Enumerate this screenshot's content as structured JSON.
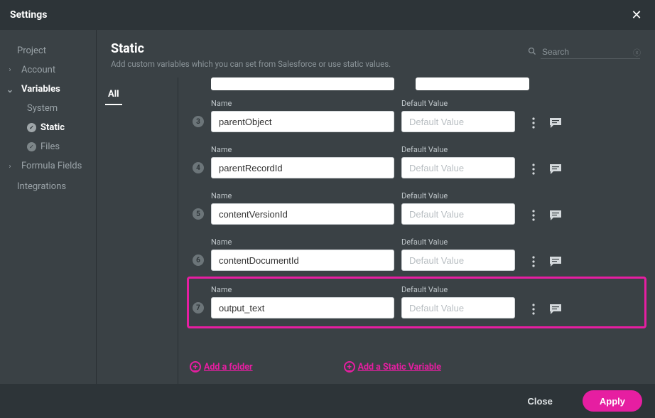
{
  "titlebar": {
    "title": "Settings"
  },
  "sidebar": {
    "items": [
      {
        "label": "Project",
        "chev": ""
      },
      {
        "label": "Account",
        "chev": "›"
      },
      {
        "label": "Variables",
        "chev": "⌄",
        "active": true
      },
      {
        "label": "System",
        "indent": true
      },
      {
        "label": "Static",
        "indent": true,
        "check": true,
        "active": true
      },
      {
        "label": "Files",
        "indent": true,
        "check": true
      },
      {
        "label": "Formula Fields",
        "chev": "›"
      },
      {
        "label": "Integrations",
        "chev": ""
      }
    ]
  },
  "header": {
    "title": "Static",
    "subtitle": "Add custom variables which you can set from Salesforce or use static values."
  },
  "search": {
    "placeholder": "Search"
  },
  "tabs": {
    "all": "All"
  },
  "labels": {
    "name": "Name",
    "default": "Default Value",
    "placeholder": "Default Value"
  },
  "variables": [
    {
      "num": "3",
      "name": "parentObject",
      "value": ""
    },
    {
      "num": "4",
      "name": "parentRecordId",
      "value": ""
    },
    {
      "num": "5",
      "name": "contentVersionId",
      "value": ""
    },
    {
      "num": "6",
      "name": "contentDocumentId",
      "value": ""
    },
    {
      "num": "7",
      "name": "output_text",
      "value": "",
      "highlight": true
    }
  ],
  "links": {
    "addFolder": "Add a folder",
    "addVar": "Add a Static Variable"
  },
  "footer": {
    "close": "Close",
    "apply": "Apply"
  }
}
